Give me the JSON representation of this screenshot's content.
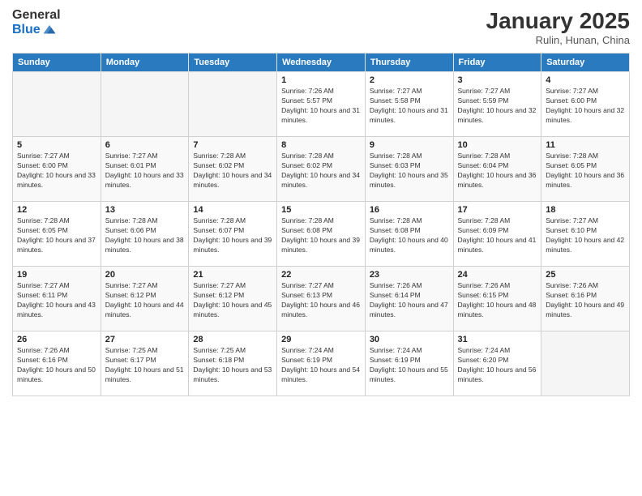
{
  "header": {
    "logo_general": "General",
    "logo_blue": "Blue",
    "month_title": "January 2025",
    "location": "Rulin, Hunan, China"
  },
  "days_of_week": [
    "Sunday",
    "Monday",
    "Tuesday",
    "Wednesday",
    "Thursday",
    "Friday",
    "Saturday"
  ],
  "weeks": [
    [
      {
        "num": "",
        "info": ""
      },
      {
        "num": "",
        "info": ""
      },
      {
        "num": "",
        "info": ""
      },
      {
        "num": "1",
        "info": "Sunrise: 7:26 AM\nSunset: 5:57 PM\nDaylight: 10 hours and 31 minutes."
      },
      {
        "num": "2",
        "info": "Sunrise: 7:27 AM\nSunset: 5:58 PM\nDaylight: 10 hours and 31 minutes."
      },
      {
        "num": "3",
        "info": "Sunrise: 7:27 AM\nSunset: 5:59 PM\nDaylight: 10 hours and 32 minutes."
      },
      {
        "num": "4",
        "info": "Sunrise: 7:27 AM\nSunset: 6:00 PM\nDaylight: 10 hours and 32 minutes."
      }
    ],
    [
      {
        "num": "5",
        "info": "Sunrise: 7:27 AM\nSunset: 6:00 PM\nDaylight: 10 hours and 33 minutes."
      },
      {
        "num": "6",
        "info": "Sunrise: 7:27 AM\nSunset: 6:01 PM\nDaylight: 10 hours and 33 minutes."
      },
      {
        "num": "7",
        "info": "Sunrise: 7:28 AM\nSunset: 6:02 PM\nDaylight: 10 hours and 34 minutes."
      },
      {
        "num": "8",
        "info": "Sunrise: 7:28 AM\nSunset: 6:02 PM\nDaylight: 10 hours and 34 minutes."
      },
      {
        "num": "9",
        "info": "Sunrise: 7:28 AM\nSunset: 6:03 PM\nDaylight: 10 hours and 35 minutes."
      },
      {
        "num": "10",
        "info": "Sunrise: 7:28 AM\nSunset: 6:04 PM\nDaylight: 10 hours and 36 minutes."
      },
      {
        "num": "11",
        "info": "Sunrise: 7:28 AM\nSunset: 6:05 PM\nDaylight: 10 hours and 36 minutes."
      }
    ],
    [
      {
        "num": "12",
        "info": "Sunrise: 7:28 AM\nSunset: 6:05 PM\nDaylight: 10 hours and 37 minutes."
      },
      {
        "num": "13",
        "info": "Sunrise: 7:28 AM\nSunset: 6:06 PM\nDaylight: 10 hours and 38 minutes."
      },
      {
        "num": "14",
        "info": "Sunrise: 7:28 AM\nSunset: 6:07 PM\nDaylight: 10 hours and 39 minutes."
      },
      {
        "num": "15",
        "info": "Sunrise: 7:28 AM\nSunset: 6:08 PM\nDaylight: 10 hours and 39 minutes."
      },
      {
        "num": "16",
        "info": "Sunrise: 7:28 AM\nSunset: 6:08 PM\nDaylight: 10 hours and 40 minutes."
      },
      {
        "num": "17",
        "info": "Sunrise: 7:28 AM\nSunset: 6:09 PM\nDaylight: 10 hours and 41 minutes."
      },
      {
        "num": "18",
        "info": "Sunrise: 7:27 AM\nSunset: 6:10 PM\nDaylight: 10 hours and 42 minutes."
      }
    ],
    [
      {
        "num": "19",
        "info": "Sunrise: 7:27 AM\nSunset: 6:11 PM\nDaylight: 10 hours and 43 minutes."
      },
      {
        "num": "20",
        "info": "Sunrise: 7:27 AM\nSunset: 6:12 PM\nDaylight: 10 hours and 44 minutes."
      },
      {
        "num": "21",
        "info": "Sunrise: 7:27 AM\nSunset: 6:12 PM\nDaylight: 10 hours and 45 minutes."
      },
      {
        "num": "22",
        "info": "Sunrise: 7:27 AM\nSunset: 6:13 PM\nDaylight: 10 hours and 46 minutes."
      },
      {
        "num": "23",
        "info": "Sunrise: 7:26 AM\nSunset: 6:14 PM\nDaylight: 10 hours and 47 minutes."
      },
      {
        "num": "24",
        "info": "Sunrise: 7:26 AM\nSunset: 6:15 PM\nDaylight: 10 hours and 48 minutes."
      },
      {
        "num": "25",
        "info": "Sunrise: 7:26 AM\nSunset: 6:16 PM\nDaylight: 10 hours and 49 minutes."
      }
    ],
    [
      {
        "num": "26",
        "info": "Sunrise: 7:26 AM\nSunset: 6:16 PM\nDaylight: 10 hours and 50 minutes."
      },
      {
        "num": "27",
        "info": "Sunrise: 7:25 AM\nSunset: 6:17 PM\nDaylight: 10 hours and 51 minutes."
      },
      {
        "num": "28",
        "info": "Sunrise: 7:25 AM\nSunset: 6:18 PM\nDaylight: 10 hours and 53 minutes."
      },
      {
        "num": "29",
        "info": "Sunrise: 7:24 AM\nSunset: 6:19 PM\nDaylight: 10 hours and 54 minutes."
      },
      {
        "num": "30",
        "info": "Sunrise: 7:24 AM\nSunset: 6:19 PM\nDaylight: 10 hours and 55 minutes."
      },
      {
        "num": "31",
        "info": "Sunrise: 7:24 AM\nSunset: 6:20 PM\nDaylight: 10 hours and 56 minutes."
      },
      {
        "num": "",
        "info": ""
      }
    ]
  ]
}
